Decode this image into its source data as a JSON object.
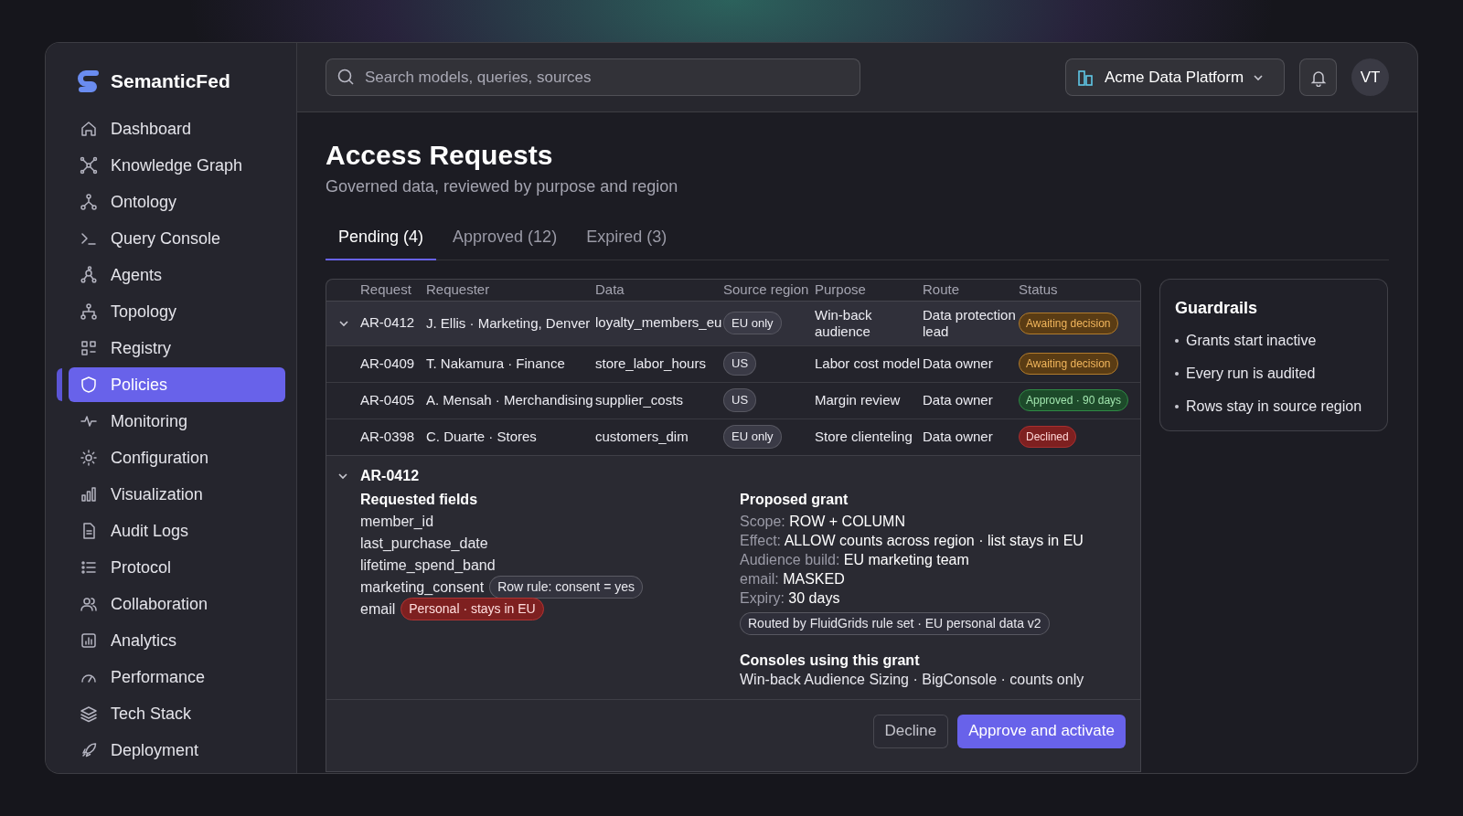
{
  "brand": "SemanticFed",
  "sidebar": {
    "items": [
      {
        "label": "Dashboard",
        "selected": false
      },
      {
        "label": "Knowledge Graph",
        "selected": false
      },
      {
        "label": "Ontology",
        "selected": false
      },
      {
        "label": "Query Console",
        "selected": false
      },
      {
        "label": "Agents",
        "selected": false
      },
      {
        "label": "Topology",
        "selected": false
      },
      {
        "label": "Registry",
        "selected": false
      },
      {
        "label": "Policies",
        "selected": true
      },
      {
        "label": "Monitoring",
        "selected": false
      },
      {
        "label": "Configuration",
        "selected": false
      },
      {
        "label": "Visualization",
        "selected": false
      },
      {
        "label": "Audit Logs",
        "selected": false
      },
      {
        "label": "Protocol",
        "selected": false
      },
      {
        "label": "Collaboration",
        "selected": false
      },
      {
        "label": "Analytics",
        "selected": false
      },
      {
        "label": "Performance",
        "selected": false
      },
      {
        "label": "Tech Stack",
        "selected": false
      },
      {
        "label": "Deployment",
        "selected": false
      }
    ]
  },
  "header": {
    "search": {
      "placeholder": "Search models, queries, sources"
    },
    "workspace": "Acme Data Platform",
    "avatar": "VT"
  },
  "page": {
    "title": "Access Requests",
    "subtitle": "Governed data, reviewed by purpose and region"
  },
  "tabs": [
    {
      "label": "Pending (4)",
      "selected": true
    },
    {
      "label": "Approved (12)",
      "selected": false
    },
    {
      "label": "Expired (3)",
      "selected": false
    }
  ],
  "table": {
    "columns": [
      "Request",
      "Requester",
      "Data",
      "Source region",
      "Purpose",
      "Route",
      "Status"
    ],
    "rows": [
      {
        "expanded": true,
        "request": "AR-0412",
        "requester": "J. Ellis · Marketing, Denver",
        "data": "loyalty_members_eu",
        "region": "EU only",
        "purpose": "Win-back audience",
        "route": "Data protection lead",
        "status": {
          "label": "Awaiting decision",
          "kind": "awaiting"
        }
      },
      {
        "expanded": false,
        "request": "AR-0409",
        "requester": "T. Nakamura · Finance",
        "data": "store_labor_hours",
        "region": "US",
        "purpose": "Labor cost model",
        "route": "Data owner",
        "status": {
          "label": "Awaiting decision",
          "kind": "awaiting"
        }
      },
      {
        "expanded": false,
        "request": "AR-0405",
        "requester": "A. Mensah · Merchandising",
        "data": "supplier_costs",
        "region": "US",
        "purpose": "Margin review",
        "route": "Data owner",
        "status": {
          "label": "Approved · 90 days",
          "kind": "approved"
        }
      },
      {
        "expanded": false,
        "request": "AR-0398",
        "requester": "C. Duarte · Stores",
        "data": "customers_dim",
        "region": "EU only",
        "purpose": "Store clienteling",
        "route": "Data owner",
        "status": {
          "label": "Declined",
          "kind": "declined"
        }
      }
    ]
  },
  "detail": {
    "id": "AR-0412",
    "expanded": true,
    "requested_fields": {
      "title": "Requested fields",
      "items": [
        {
          "name": "member_id"
        },
        {
          "name": "last_purchase_date"
        },
        {
          "name": "lifetime_spend_band"
        },
        {
          "name": "marketing_consent",
          "tag": {
            "label": "Row rule: consent = yes",
            "kind": "rule"
          }
        },
        {
          "name": "email",
          "tag": {
            "label": "Personal · stays in EU",
            "kind": "personal"
          }
        }
      ]
    },
    "proposed_grant": {
      "title": "Proposed grant",
      "lines": [
        {
          "label": "Scope:",
          "value": "ROW + COLUMN"
        },
        {
          "label": "Effect:",
          "value": "ALLOW counts across region · list stays in EU"
        },
        {
          "label": "Audience build:",
          "value": "EU marketing team"
        },
        {
          "label": "email:",
          "value": "MASKED"
        },
        {
          "label": "Expiry:",
          "value": "30 days"
        }
      ],
      "route_tag": "Routed by FluidGrids rule set · EU personal data v2"
    },
    "consoles": {
      "title": "Consoles using this grant",
      "text": "Win-back Audience Sizing · BigConsole · counts only"
    },
    "buttons": {
      "decline": "Decline",
      "approve": "Approve and activate"
    }
  },
  "guardrails": {
    "title": "Guardrails",
    "items": [
      "Grants start inactive",
      "Every run is audited",
      "Rows stay in source region"
    ]
  }
}
